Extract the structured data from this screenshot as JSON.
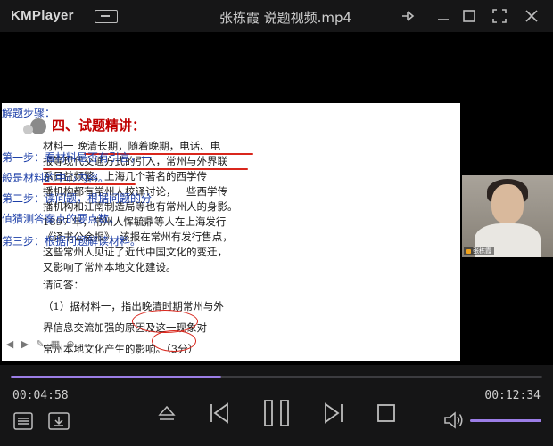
{
  "app": {
    "brand": "KMPlayer",
    "title": "张栋霞   说题视频.mp4"
  },
  "slide": {
    "heading": "四、试题精讲：",
    "material_lines": [
      "材料一  晚清长期，随着晚期，电话、电",
      "报等现代交通方式的引入，常州与外界联",
      "系日益频繁，上海几个著名的西学传",
      "播机构都有常州人校译讨论，一些西学传",
      "播机构和江南制造局等也有常州人的身影。",
      "1897 年，常州人恽毓鼎等人在上海发行",
      "《译书公会报》，该报在常州有发行售点，",
      "这些常州人见证了近代中国文化的变迁，",
      "又影响了常州本地文化建设。"
    ],
    "question_lines": [
      "请问答：",
      "（1）据材料一，指出晚清时期常州与外",
      "      界信息交流加强的原因及这一现象对",
      "      常州本地文化产生的影响。（3分）"
    ],
    "steps_title": "解题步骤：",
    "steps": [
      "第一步：看材料是否有引言，一",
      "    般是材料的中心内容。",
      "第二步：读问题，根据问题的分",
      "    值猜测答案点的要点数。",
      "第三步：根据问题解读材料。"
    ]
  },
  "camera": {
    "badge": "张栋霞"
  },
  "playback": {
    "current_time": "00:04:58",
    "total_time": "00:12:34",
    "progress_fraction": 0.396,
    "volume_fraction": 1.0,
    "accent_color": "#9b7de6"
  },
  "icons": [
    "menu-icon",
    "pin-icon",
    "minimize-icon",
    "maximize-icon",
    "fullscreen-icon",
    "close-icon",
    "playlist-icon",
    "download-icon",
    "eject-icon",
    "previous-icon",
    "pause-icon",
    "next-icon",
    "stop-icon",
    "volume-icon"
  ]
}
